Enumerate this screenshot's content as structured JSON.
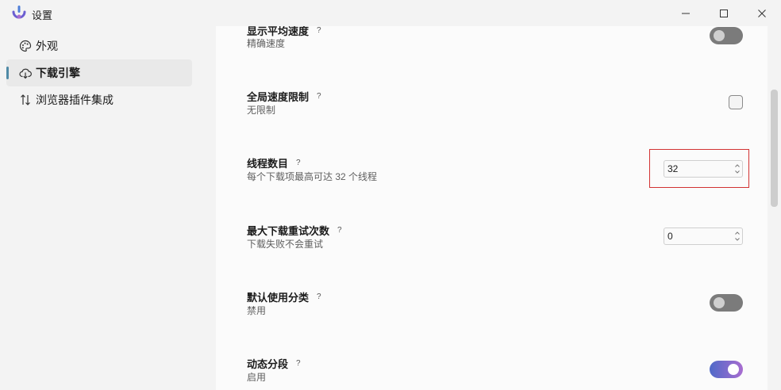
{
  "window": {
    "title": "设置"
  },
  "sidebar": {
    "items": [
      {
        "label": "外观",
        "icon": "palette-icon",
        "selected": false
      },
      {
        "label": "下载引擎",
        "icon": "cloud-download-icon",
        "selected": true
      },
      {
        "label": "浏览器插件集成",
        "icon": "sort-arrows-icon",
        "selected": false
      }
    ]
  },
  "settings": {
    "avg_speed": {
      "label": "显示平均速度",
      "help": "?",
      "desc": "精确速度",
      "enabled": false
    },
    "global_limit": {
      "label": "全局速度限制",
      "help": "?",
      "desc": "无限制",
      "checked": false
    },
    "threads": {
      "label": "线程数目",
      "help": "?",
      "desc": "每个下载项最高可达 32 个线程",
      "value": "32"
    },
    "retries": {
      "label": "最大下载重试次数",
      "help": "?",
      "desc": "下载失败不会重试",
      "value": "0"
    },
    "default_category": {
      "label": "默认使用分类",
      "help": "?",
      "desc": "禁用",
      "enabled": false
    },
    "dynamic_segment": {
      "label": "动态分段",
      "help": "?",
      "desc": "启用",
      "enabled": true
    }
  },
  "colors": {
    "accent_start": "#4f69c8",
    "accent_end": "#a86dd0",
    "highlight": "#d23232",
    "indicator": "#4f8aa6"
  }
}
